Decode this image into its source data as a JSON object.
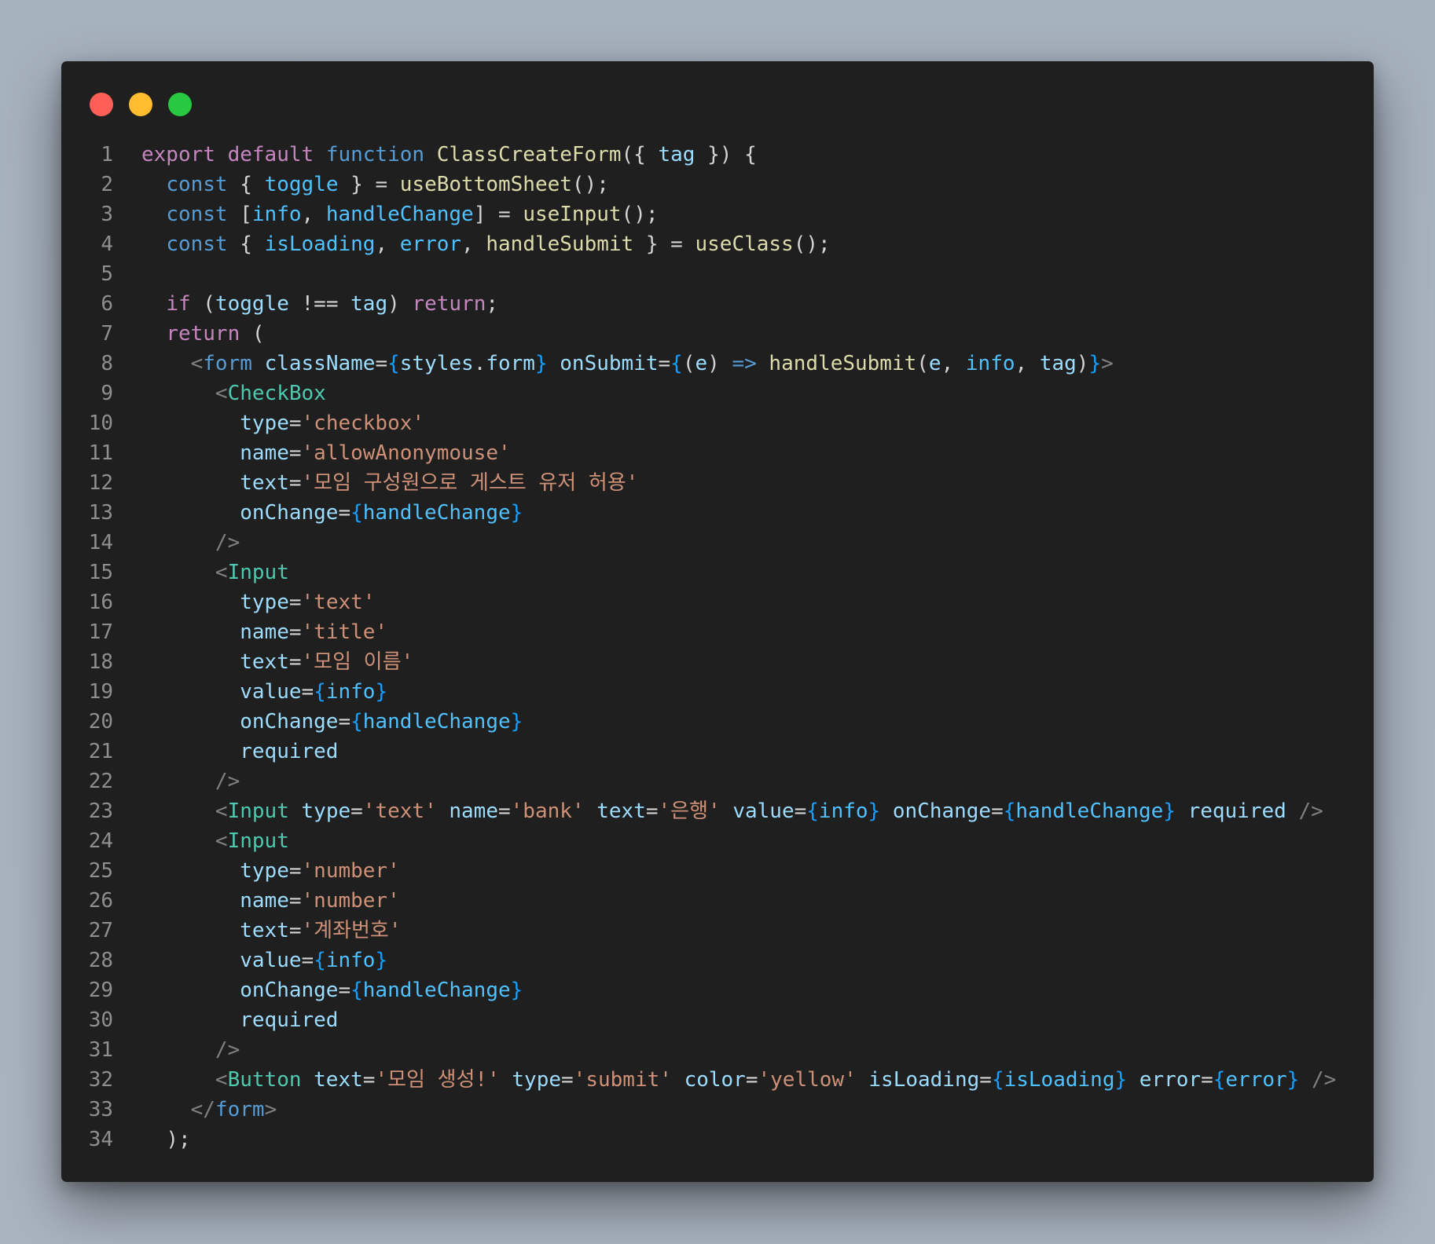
{
  "window": {
    "controls": [
      "close",
      "minimize",
      "maximize"
    ]
  },
  "colors": {
    "keyword": "#c586c0",
    "declaration": "#569cd6",
    "function": "#dcdcaa",
    "variable": "#9cdcfe",
    "string": "#ce9178",
    "component": "#4ec9b0",
    "punctuation": "#808080",
    "brace": "#179fff",
    "text": "#d4d4d4",
    "line_number": "#8f8f8f",
    "background": "#1f1f1f"
  },
  "lines": [
    {
      "n": "1",
      "indent": 0,
      "tokens": [
        [
          "export",
          "kw"
        ],
        [
          " ",
          "plain"
        ],
        [
          "default",
          "kw"
        ],
        [
          " ",
          "plain"
        ],
        [
          "function",
          "dec"
        ],
        [
          " ",
          "plain"
        ],
        [
          "ClassCreateForm",
          "fn"
        ],
        [
          "({ ",
          "plain"
        ],
        [
          "tag",
          "var"
        ],
        [
          " }) {",
          "plain"
        ]
      ]
    },
    {
      "n": "2",
      "indent": 2,
      "tokens": [
        [
          "const",
          "dec"
        ],
        [
          " { ",
          "plain"
        ],
        [
          "toggle",
          "const"
        ],
        [
          " } = ",
          "plain"
        ],
        [
          "useBottomSheet",
          "fn"
        ],
        [
          "();",
          "plain"
        ]
      ]
    },
    {
      "n": "3",
      "indent": 2,
      "tokens": [
        [
          "const",
          "dec"
        ],
        [
          " [",
          "plain"
        ],
        [
          "info",
          "const"
        ],
        [
          ", ",
          "plain"
        ],
        [
          "handleChange",
          "const"
        ],
        [
          "] = ",
          "plain"
        ],
        [
          "useInput",
          "fn"
        ],
        [
          "();",
          "plain"
        ]
      ]
    },
    {
      "n": "4",
      "indent": 2,
      "tokens": [
        [
          "const",
          "dec"
        ],
        [
          " { ",
          "plain"
        ],
        [
          "isLoading",
          "const"
        ],
        [
          ", ",
          "plain"
        ],
        [
          "error",
          "const"
        ],
        [
          ", ",
          "plain"
        ],
        [
          "handleSubmit",
          "fn"
        ],
        [
          " } = ",
          "plain"
        ],
        [
          "useClass",
          "fn"
        ],
        [
          "();",
          "plain"
        ]
      ]
    },
    {
      "n": "5",
      "indent": 0,
      "tokens": []
    },
    {
      "n": "6",
      "indent": 2,
      "tokens": [
        [
          "if",
          "kw"
        ],
        [
          " (",
          "plain"
        ],
        [
          "toggle",
          "var"
        ],
        [
          " !== ",
          "plain"
        ],
        [
          "tag",
          "var"
        ],
        [
          ") ",
          "plain"
        ],
        [
          "return",
          "kw"
        ],
        [
          ";",
          "plain"
        ]
      ]
    },
    {
      "n": "7",
      "indent": 2,
      "tokens": [
        [
          "return",
          "kw"
        ],
        [
          " (",
          "plain"
        ]
      ]
    },
    {
      "n": "8",
      "indent": 4,
      "tokens": [
        [
          "<",
          "punct"
        ],
        [
          "form",
          "tagname"
        ],
        [
          " ",
          "plain"
        ],
        [
          "className",
          "attr"
        ],
        [
          "=",
          "plain"
        ],
        [
          "{",
          "brace"
        ],
        [
          "styles",
          "var"
        ],
        [
          ".",
          "plain"
        ],
        [
          "form",
          "var"
        ],
        [
          "}",
          "brace"
        ],
        [
          " ",
          "plain"
        ],
        [
          "onSubmit",
          "attr"
        ],
        [
          "=",
          "plain"
        ],
        [
          "{",
          "brace"
        ],
        [
          "(",
          "plain"
        ],
        [
          "e",
          "var"
        ],
        [
          ") ",
          "plain"
        ],
        [
          "=>",
          "dec"
        ],
        [
          " ",
          "plain"
        ],
        [
          "handleSubmit",
          "fn"
        ],
        [
          "(",
          "plain"
        ],
        [
          "e",
          "var"
        ],
        [
          ", ",
          "plain"
        ],
        [
          "info",
          "const"
        ],
        [
          ", ",
          "plain"
        ],
        [
          "tag",
          "var"
        ],
        [
          ")",
          "plain"
        ],
        [
          "}",
          "brace"
        ],
        [
          ">",
          "punct"
        ]
      ]
    },
    {
      "n": "9",
      "indent": 6,
      "tokens": [
        [
          "<",
          "punct"
        ],
        [
          "CheckBox",
          "tag"
        ]
      ]
    },
    {
      "n": "10",
      "indent": 8,
      "tokens": [
        [
          "type",
          "attr"
        ],
        [
          "=",
          "plain"
        ],
        [
          "'checkbox'",
          "str"
        ]
      ]
    },
    {
      "n": "11",
      "indent": 8,
      "tokens": [
        [
          "name",
          "attr"
        ],
        [
          "=",
          "plain"
        ],
        [
          "'allowAnonymouse'",
          "str"
        ]
      ]
    },
    {
      "n": "12",
      "indent": 8,
      "tokens": [
        [
          "text",
          "attr"
        ],
        [
          "=",
          "plain"
        ],
        [
          "'모임 구성원으로 게스트 유저 허용'",
          "str"
        ]
      ]
    },
    {
      "n": "13",
      "indent": 8,
      "tokens": [
        [
          "onChange",
          "attr"
        ],
        [
          "=",
          "plain"
        ],
        [
          "{",
          "brace"
        ],
        [
          "handleChange",
          "const"
        ],
        [
          "}",
          "brace"
        ]
      ]
    },
    {
      "n": "14",
      "indent": 6,
      "tokens": [
        [
          "/>",
          "punct"
        ]
      ]
    },
    {
      "n": "15",
      "indent": 6,
      "tokens": [
        [
          "<",
          "punct"
        ],
        [
          "Input",
          "tag"
        ]
      ]
    },
    {
      "n": "16",
      "indent": 8,
      "tokens": [
        [
          "type",
          "attr"
        ],
        [
          "=",
          "plain"
        ],
        [
          "'text'",
          "str"
        ]
      ]
    },
    {
      "n": "17",
      "indent": 8,
      "tokens": [
        [
          "name",
          "attr"
        ],
        [
          "=",
          "plain"
        ],
        [
          "'title'",
          "str"
        ]
      ]
    },
    {
      "n": "18",
      "indent": 8,
      "tokens": [
        [
          "text",
          "attr"
        ],
        [
          "=",
          "plain"
        ],
        [
          "'모임 이름'",
          "str"
        ]
      ]
    },
    {
      "n": "19",
      "indent": 8,
      "tokens": [
        [
          "value",
          "attr"
        ],
        [
          "=",
          "plain"
        ],
        [
          "{",
          "brace"
        ],
        [
          "info",
          "const"
        ],
        [
          "}",
          "brace"
        ]
      ]
    },
    {
      "n": "20",
      "indent": 8,
      "tokens": [
        [
          "onChange",
          "attr"
        ],
        [
          "=",
          "plain"
        ],
        [
          "{",
          "brace"
        ],
        [
          "handleChange",
          "const"
        ],
        [
          "}",
          "brace"
        ]
      ]
    },
    {
      "n": "21",
      "indent": 8,
      "tokens": [
        [
          "required",
          "attr"
        ]
      ]
    },
    {
      "n": "22",
      "indent": 6,
      "tokens": [
        [
          "/>",
          "punct"
        ]
      ]
    },
    {
      "n": "23",
      "indent": 6,
      "tokens": [
        [
          "<",
          "punct"
        ],
        [
          "Input",
          "tag"
        ],
        [
          " ",
          "plain"
        ],
        [
          "type",
          "attr"
        ],
        [
          "=",
          "plain"
        ],
        [
          "'text'",
          "str"
        ],
        [
          " ",
          "plain"
        ],
        [
          "name",
          "attr"
        ],
        [
          "=",
          "plain"
        ],
        [
          "'bank'",
          "str"
        ],
        [
          " ",
          "plain"
        ],
        [
          "text",
          "attr"
        ],
        [
          "=",
          "plain"
        ],
        [
          "'은행'",
          "str"
        ],
        [
          " ",
          "plain"
        ],
        [
          "value",
          "attr"
        ],
        [
          "=",
          "plain"
        ],
        [
          "{",
          "brace"
        ],
        [
          "info",
          "const"
        ],
        [
          "}",
          "brace"
        ],
        [
          " ",
          "plain"
        ],
        [
          "onChange",
          "attr"
        ],
        [
          "=",
          "plain"
        ],
        [
          "{",
          "brace"
        ],
        [
          "handleChange",
          "const"
        ],
        [
          "}",
          "brace"
        ],
        [
          " ",
          "plain"
        ],
        [
          "required",
          "attr"
        ],
        [
          " ",
          "plain"
        ],
        [
          "/>",
          "punct"
        ]
      ]
    },
    {
      "n": "24",
      "indent": 6,
      "tokens": [
        [
          "<",
          "punct"
        ],
        [
          "Input",
          "tag"
        ]
      ]
    },
    {
      "n": "25",
      "indent": 8,
      "tokens": [
        [
          "type",
          "attr"
        ],
        [
          "=",
          "plain"
        ],
        [
          "'number'",
          "str"
        ]
      ]
    },
    {
      "n": "26",
      "indent": 8,
      "tokens": [
        [
          "name",
          "attr"
        ],
        [
          "=",
          "plain"
        ],
        [
          "'number'",
          "str"
        ]
      ]
    },
    {
      "n": "27",
      "indent": 8,
      "tokens": [
        [
          "text",
          "attr"
        ],
        [
          "=",
          "plain"
        ],
        [
          "'계좌번호'",
          "str"
        ]
      ]
    },
    {
      "n": "28",
      "indent": 8,
      "tokens": [
        [
          "value",
          "attr"
        ],
        [
          "=",
          "plain"
        ],
        [
          "{",
          "brace"
        ],
        [
          "info",
          "const"
        ],
        [
          "}",
          "brace"
        ]
      ]
    },
    {
      "n": "29",
      "indent": 8,
      "tokens": [
        [
          "onChange",
          "attr"
        ],
        [
          "=",
          "plain"
        ],
        [
          "{",
          "brace"
        ],
        [
          "handleChange",
          "const"
        ],
        [
          "}",
          "brace"
        ]
      ]
    },
    {
      "n": "30",
      "indent": 8,
      "tokens": [
        [
          "required",
          "attr"
        ]
      ]
    },
    {
      "n": "31",
      "indent": 6,
      "tokens": [
        [
          "/>",
          "punct"
        ]
      ]
    },
    {
      "n": "32",
      "indent": 6,
      "tokens": [
        [
          "<",
          "punct"
        ],
        [
          "Button",
          "tag"
        ],
        [
          " ",
          "plain"
        ],
        [
          "text",
          "attr"
        ],
        [
          "=",
          "plain"
        ],
        [
          "'모임 생성!'",
          "str"
        ],
        [
          " ",
          "plain"
        ],
        [
          "type",
          "attr"
        ],
        [
          "=",
          "plain"
        ],
        [
          "'submit'",
          "str"
        ],
        [
          " ",
          "plain"
        ],
        [
          "color",
          "attr"
        ],
        [
          "=",
          "plain"
        ],
        [
          "'yellow'",
          "str"
        ],
        [
          " ",
          "plain"
        ],
        [
          "isLoading",
          "attr"
        ],
        [
          "=",
          "plain"
        ],
        [
          "{",
          "brace"
        ],
        [
          "isLoading",
          "const"
        ],
        [
          "}",
          "brace"
        ],
        [
          " ",
          "plain"
        ],
        [
          "error",
          "attr"
        ],
        [
          "=",
          "plain"
        ],
        [
          "{",
          "brace"
        ],
        [
          "error",
          "const"
        ],
        [
          "}",
          "brace"
        ],
        [
          " ",
          "plain"
        ],
        [
          "/>",
          "punct"
        ]
      ]
    },
    {
      "n": "33",
      "indent": 4,
      "tokens": [
        [
          "</",
          "punct"
        ],
        [
          "form",
          "tagname"
        ],
        [
          ">",
          "punct"
        ]
      ]
    },
    {
      "n": "34",
      "indent": 2,
      "tokens": [
        [
          ");",
          "plain"
        ]
      ]
    }
  ]
}
